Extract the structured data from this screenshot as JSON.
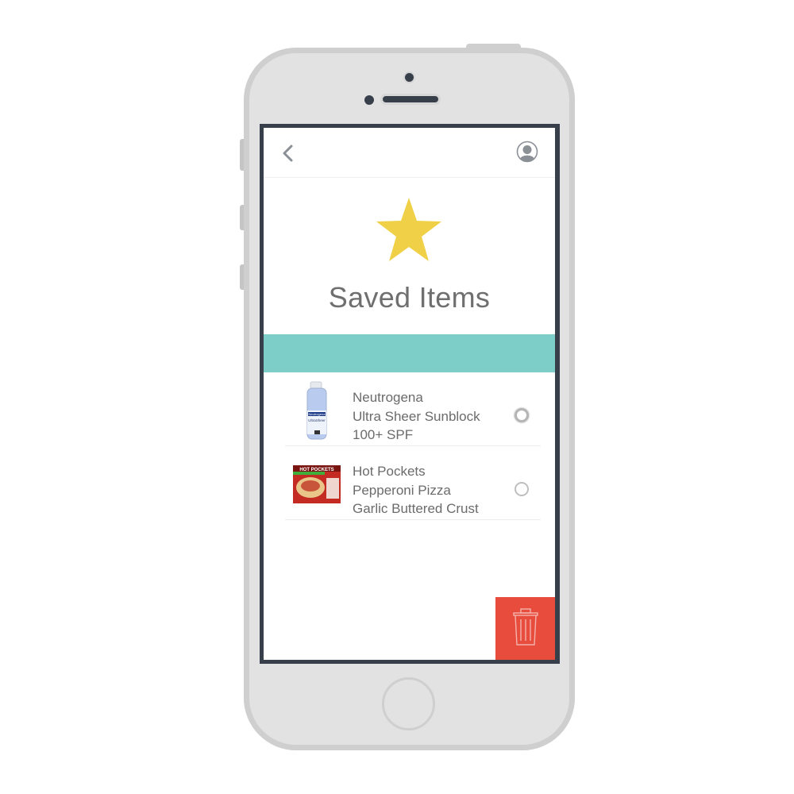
{
  "header": {
    "back_icon": "chevron-left-icon",
    "profile_icon": "user-avatar-icon"
  },
  "hero": {
    "icon": "star-icon",
    "star_color": "#f0d046",
    "title": "Saved Items"
  },
  "accent_band_color": "#7dcdc8",
  "items": [
    {
      "lines": [
        "Neutrogena",
        "Ultra Sheer Sunblock",
        "100+ SPF"
      ],
      "image": "sunscreen-spray-can",
      "image_label": "Neutrogena",
      "image_sublabel": "UltraSheer",
      "selected": false
    },
    {
      "lines": [
        "Hot Pockets",
        "Pepperoni Pizza",
        "Garlic Buttered Crust"
      ],
      "image": "hot-pockets-box",
      "image_label": "HOT POCKETS",
      "selected": false
    }
  ],
  "actions": {
    "delete_icon": "trash-icon",
    "delete_color": "#e84c3d"
  }
}
